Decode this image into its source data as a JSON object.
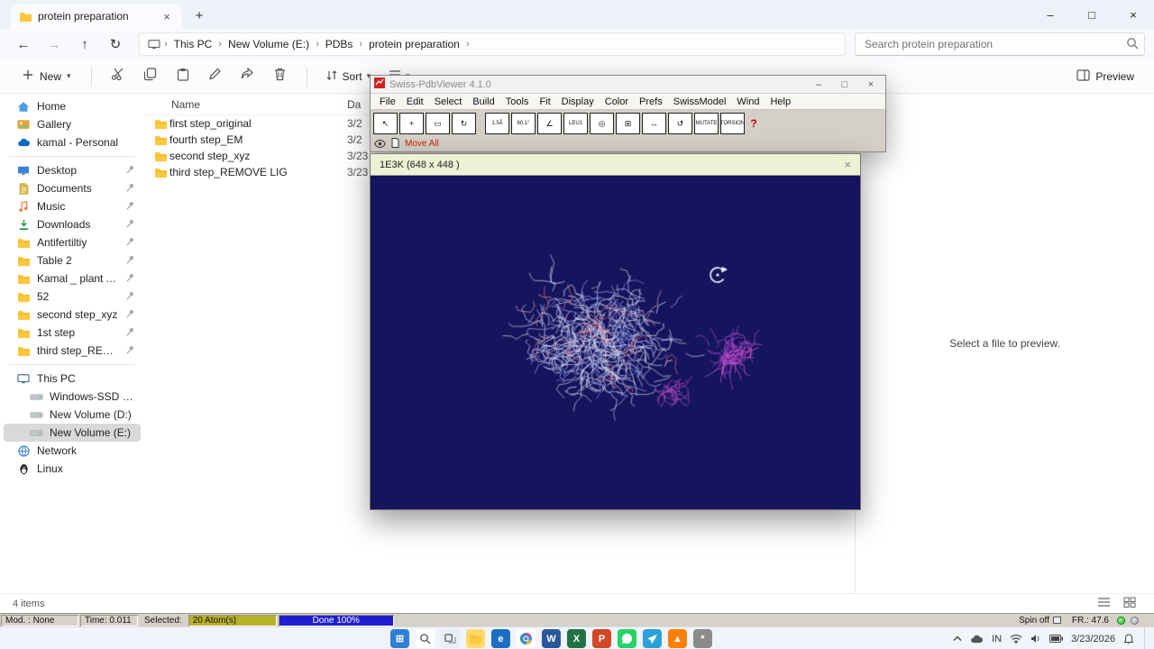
{
  "explorer": {
    "tab_title": "protein preparation",
    "new_tab": "+",
    "window_controls": {
      "minimize": "–",
      "maximize": "□",
      "close": "×"
    },
    "nav_buttons": [
      {
        "name": "back",
        "glyph": "←",
        "disabled": false
      },
      {
        "name": "forward",
        "glyph": "→",
        "disabled": true
      },
      {
        "name": "up",
        "glyph": "↑",
        "disabled": false
      },
      {
        "name": "refresh",
        "glyph": "↻",
        "disabled": false
      }
    ],
    "breadcrumb": [
      "This PC",
      "New Volume (E:)",
      "PDBs",
      "protein preparation"
    ],
    "search_placeholder": "Search protein preparation",
    "toolbar": {
      "new": "New",
      "sort": "Sort",
      "preview": "Preview"
    },
    "command_icons": [
      "cut",
      "copy",
      "paste",
      "rename",
      "share",
      "delete"
    ],
    "columns": {
      "name": "Name",
      "date": "Da"
    },
    "files": [
      {
        "name": "first step_original",
        "date": "3/2"
      },
      {
        "name": "fourth step_EM",
        "date": "3/2"
      },
      {
        "name": "second step_xyz",
        "date": "3/23"
      },
      {
        "name": "third step_REMOVE LIG",
        "date": "3/23"
      }
    ],
    "sidebar": [
      {
        "label": "Home",
        "icon": "home"
      },
      {
        "label": "Gallery",
        "icon": "gallery"
      },
      {
        "label": "kamal - Personal",
        "icon": "onedrive",
        "sep_after": true
      },
      {
        "label": "Desktop",
        "icon": "desktop",
        "pinned": true
      },
      {
        "label": "Documents",
        "icon": "documents",
        "pinned": true
      },
      {
        "label": "Music",
        "icon": "music",
        "pinned": true
      },
      {
        "label": "Downloads",
        "icon": "downloads",
        "pinned": true
      },
      {
        "label": "Antifertiltiy",
        "icon": "folder",
        "pinned": true
      },
      {
        "label": "Table 2",
        "icon": "folder",
        "pinned": true
      },
      {
        "label": "Kamal _ plant AP",
        "icon": "folder",
        "pinned": true
      },
      {
        "label": "52",
        "icon": "folder",
        "pinned": true
      },
      {
        "label": "second step_xyz",
        "icon": "folder",
        "pinned": true
      },
      {
        "label": "1st step",
        "icon": "folder",
        "pinned": true
      },
      {
        "label": "third step_REMOVE LIG",
        "icon": "folder",
        "pinned": true,
        "sep_after": true
      },
      {
        "label": "This PC",
        "icon": "thispc"
      },
      {
        "label": "Windows-SSD (C:)",
        "icon": "drive",
        "indent": 1
      },
      {
        "label": "New Volume (D:)",
        "icon": "drive",
        "indent": 1
      },
      {
        "label": "New Volume (E:)",
        "icon": "drive",
        "indent": 1,
        "selected": true
      },
      {
        "label": "Network",
        "icon": "network"
      },
      {
        "label": "Linux",
        "icon": "linux"
      }
    ],
    "status_items": "4 items",
    "preview_empty": "Select a file to preview."
  },
  "spdbv": {
    "title": "Swiss-PdbViewer 4.1.0",
    "window_controls": {
      "minimize": "–",
      "maximize": "□",
      "close": "×"
    },
    "menus": [
      "File",
      "Edit",
      "Select",
      "Build",
      "Tools",
      "Fit",
      "Display",
      "Color",
      "Prefs",
      "SwissModel",
      "Wind",
      "Help"
    ],
    "tools": [
      {
        "name": "pick-tool",
        "glyph": "↖"
      },
      {
        "name": "move-tool",
        "glyph": "+"
      },
      {
        "name": "slab-tool",
        "glyph": "▭"
      },
      {
        "name": "rotate-tool",
        "glyph": "↻",
        "gap_after": true
      },
      {
        "name": "distance-tool",
        "glyph": "1.5Å",
        "small": true
      },
      {
        "name": "angle-tool",
        "glyph": "60.1°",
        "small": true
      },
      {
        "name": "dihedral-tool",
        "glyph": "∠"
      },
      {
        "name": "label-tool",
        "glyph": "LEU1",
        "small": true
      },
      {
        "name": "center-tool",
        "glyph": "◎"
      },
      {
        "name": "fit-window-tool",
        "glyph": "⊞"
      },
      {
        "name": "move-group-tool",
        "glyph": "↔"
      },
      {
        "name": "rotate-group-tool",
        "glyph": "↺"
      },
      {
        "name": "mutate-tool",
        "glyph": "MUTATE",
        "small": true
      },
      {
        "name": "torsion-tool",
        "glyph": "TORSION",
        "small": true
      }
    ],
    "help_glyph": "?",
    "move_all": "Move All",
    "status": {
      "mod": "Mod. : None",
      "time": "Time: 0.011",
      "selected_label": "Selected:",
      "selected_value": "20 Atom(s)",
      "progress": "Done 100%",
      "spin": "Spin off",
      "fr": "FR.: 47.6"
    }
  },
  "viewer": {
    "title": "1E3K  (648 x 448 )",
    "close": "×",
    "canvas_bg": "#15155e",
    "accent_magenta": "#cc4fd0"
  },
  "taskbar": {
    "lang": "IN",
    "date": "3/23/2026",
    "icons": [
      {
        "name": "start",
        "bg": "#2f7fd6",
        "fg": "#ffffff",
        "glyph": "⊞"
      },
      {
        "name": "search",
        "bg": "#ffffff",
        "fg": "#444444",
        "svg": "magnifier"
      },
      {
        "name": "task-view",
        "bg": "#e8eef7",
        "fg": "#333333",
        "svg": "taskview"
      },
      {
        "name": "file-explorer",
        "bg": "#ffd969",
        "fg": "#2b5fb0",
        "svg": "folder"
      },
      {
        "name": "edge",
        "bg": "#1b6ec2",
        "fg": "#ffffff",
        "glyph": "e"
      },
      {
        "name": "chrome",
        "bg": "#ffffff",
        "fg": "#4285f4",
        "svg": "chrome"
      },
      {
        "name": "word",
        "bg": "#2b579a",
        "fg": "#ffffff",
        "glyph": "W"
      },
      {
        "name": "excel",
        "bg": "#217346",
        "fg": "#ffffff",
        "glyph": "X"
      },
      {
        "name": "powerpoint",
        "bg": "#d24726",
        "fg": "#ffffff",
        "glyph": "P"
      },
      {
        "name": "whatsapp",
        "bg": "#25d366",
        "fg": "#ffffff",
        "svg": "chat"
      },
      {
        "name": "telegram",
        "bg": "#2aa1da",
        "fg": "#ffffff",
        "svg": "plane"
      },
      {
        "name": "vlc",
        "bg": "#ff7f00",
        "fg": "#ffffff",
        "glyph": "▲"
      },
      {
        "name": "settings",
        "bg": "#8a8a8a",
        "fg": "#ffffff",
        "glyph": "*"
      }
    ]
  }
}
